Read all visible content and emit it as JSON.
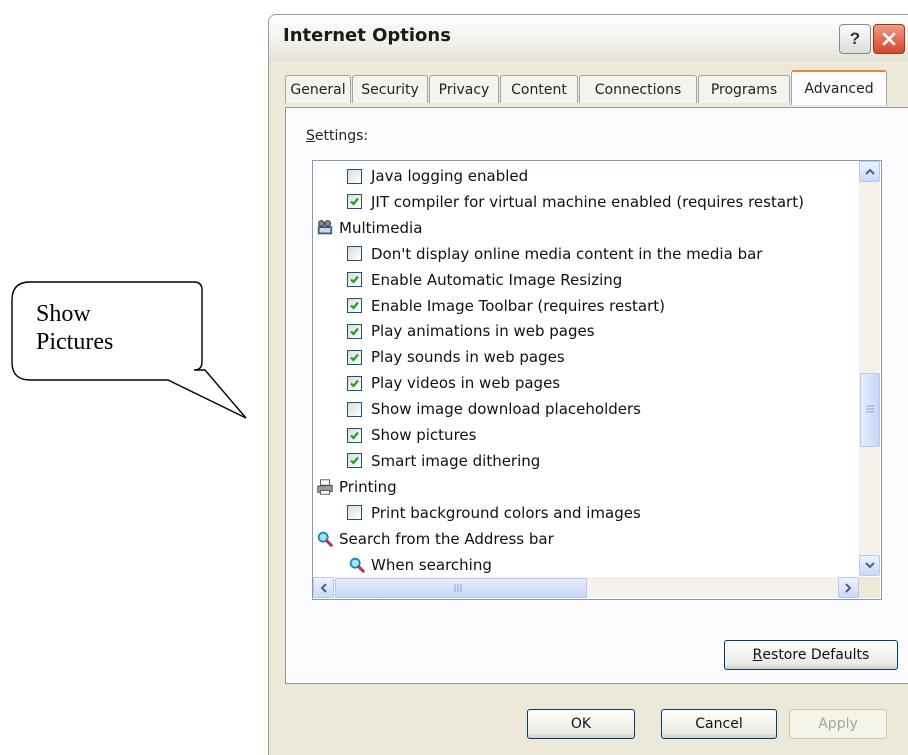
{
  "callout": {
    "line1": "Show",
    "line2": "Pictures"
  },
  "dialog": {
    "title": "Internet Options",
    "help_glyph": "?",
    "tabs": [
      "General",
      "Security",
      "Privacy",
      "Content",
      "Connections",
      "Programs",
      "Advanced"
    ],
    "active_tab": "Advanced",
    "settings_label": "ettings:",
    "settings_label_accel": "S",
    "rows": [
      {
        "kind": "checkbox",
        "label": "Java logging enabled",
        "checked": false
      },
      {
        "kind": "checkbox",
        "label": "JIT compiler for virtual machine enabled (requires restart)",
        "checked": true
      },
      {
        "kind": "category",
        "label": "Multimedia",
        "icon": "multimedia-icon"
      },
      {
        "kind": "checkbox",
        "label": "Don't display online media content in the media bar",
        "checked": false
      },
      {
        "kind": "checkbox",
        "label": "Enable Automatic Image Resizing",
        "checked": true
      },
      {
        "kind": "checkbox",
        "label": "Enable Image Toolbar (requires restart)",
        "checked": true
      },
      {
        "kind": "checkbox",
        "label": "Play animations in web pages",
        "checked": true
      },
      {
        "kind": "checkbox",
        "label": "Play sounds in web pages",
        "checked": true
      },
      {
        "kind": "checkbox",
        "label": "Play videos in web pages",
        "checked": true
      },
      {
        "kind": "checkbox",
        "label": "Show image download placeholders",
        "checked": false
      },
      {
        "kind": "checkbox",
        "label": "Show pictures",
        "checked": true
      },
      {
        "kind": "checkbox",
        "label": "Smart image dithering",
        "checked": true
      },
      {
        "kind": "category",
        "label": "Printing",
        "icon": "printer-icon"
      },
      {
        "kind": "checkbox",
        "label": "Print background colors and images",
        "checked": false
      },
      {
        "kind": "category",
        "label": "Search from the Address bar",
        "icon": "search-icon"
      },
      {
        "kind": "subcategory",
        "label": "When searching",
        "icon": "search-icon"
      }
    ],
    "restore_defaults": {
      "accel": "R",
      "rest": "estore Defaults"
    },
    "ok_label": "OK",
    "cancel_label": "Cancel",
    "apply_label": "Apply",
    "colors": {
      "check": "#21a121",
      "accent_tab": "#e68b2c",
      "title_close": "#d2452b"
    }
  }
}
